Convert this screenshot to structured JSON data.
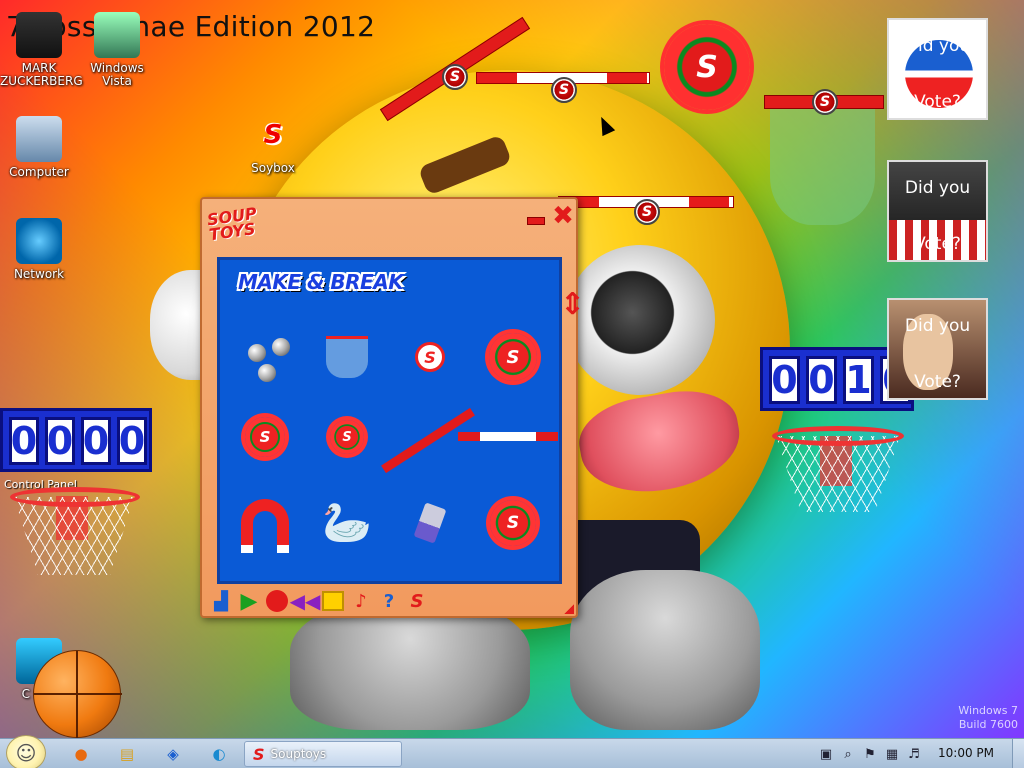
{
  "desktop": {
    "title": "7 PossKanae Edition 2012",
    "watermark": {
      "line1": "Windows 7",
      "line2": "Build 7600"
    },
    "icons": [
      {
        "label": "MARK ZUCKERBERG",
        "icon": "person-icon"
      },
      {
        "label": "Windows Vista",
        "icon": "recycle-bin-icon"
      },
      {
        "label": "Computer",
        "icon": "computer-icon"
      },
      {
        "label": "Network",
        "icon": "network-icon"
      },
      {
        "label": "Soybox",
        "icon": "soybox-icon"
      },
      {
        "label": "C CLE",
        "icon": "cleaner-icon"
      }
    ],
    "overlapped_label": "Control Panel"
  },
  "scoreboards": {
    "left": [
      "0",
      "0",
      "0",
      "0"
    ],
    "right": [
      "0",
      "0",
      "1",
      "0"
    ]
  },
  "gadgets": [
    {
      "line1": "Did you",
      "line2": "Vote?"
    },
    {
      "line1": "Did you",
      "line2": "Vote?"
    },
    {
      "line1": "Did you",
      "line2": "Vote?"
    }
  ],
  "souptoys": {
    "logo_line1": "SOUP",
    "logo_line2": "TOYS",
    "heading": "MAKE & BREAK",
    "toys": [
      "steel-balls",
      "glass-bucket",
      "pin-s",
      "red-gear",
      "small-red-gear",
      "spiky-star",
      "seesaw-stick",
      "striped-stick",
      "magnet",
      "goose",
      "eraser",
      "blue-gear"
    ],
    "toolbar": [
      "tool",
      "play",
      "record",
      "rewind",
      "box",
      "music",
      "help",
      "souptoys"
    ]
  },
  "taskbar": {
    "start_glyph": "☺",
    "pinned": [
      {
        "name": "firefox",
        "glyph": "●"
      },
      {
        "name": "explorer",
        "glyph": "▤"
      },
      {
        "name": "shield",
        "glyph": "◈"
      },
      {
        "name": "edge",
        "glyph": "◐"
      }
    ],
    "task_label": "Souptoys",
    "clock": "10:00 PM"
  },
  "colors": {
    "accent_red": "#e21b1b",
    "panel_blue": "#0a5ad6",
    "window_orange": "#f5b07a"
  }
}
